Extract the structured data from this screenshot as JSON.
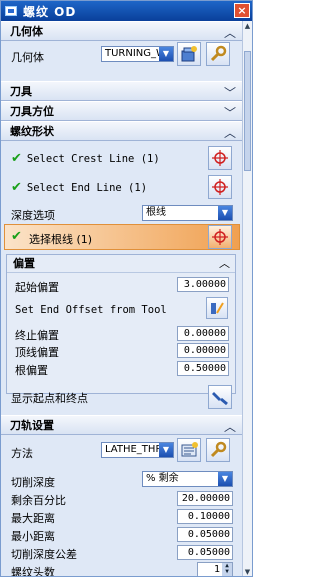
{
  "window": {
    "title": "螺纹 OD",
    "close_label": "×"
  },
  "geometry_section": {
    "header": "几何体",
    "label": "几何体",
    "value": "TURNING_WO"
  },
  "tool_section": {
    "header": "刀具"
  },
  "tool_orientation_section": {
    "header": "刀具方位"
  },
  "thread_section": {
    "header": "螺纹形状",
    "crest_line": "Select Crest Line (1)",
    "end_line": "Select End Line (1)",
    "depth_option_label": "深度选项",
    "depth_option_value": "根线",
    "root_line": "选择根线 (1)",
    "offset_panel": {
      "header": "偏置",
      "start_offset_label": "起始偏置",
      "start_offset_value": "3.00000",
      "end_offset_from_tool": "Set End Offset from Tool",
      "end_offset_label": "终止偏置",
      "end_offset_value": "0.00000",
      "crest_offset_label": "顶线偏置",
      "crest_offset_value": "0.00000",
      "root_offset_label": "根偏置",
      "root_offset_value": "0.50000"
    },
    "show_start_end_label": "显示起点和终点"
  },
  "path_settings_section": {
    "header": "刀轨设置",
    "method_label": "方法",
    "method_value": "LATHE_THREA",
    "cut_depth_label": "切削深度",
    "cut_depth_value": "% 剩余",
    "remaining_pct_label": "剩余百分比",
    "remaining_pct_value": "20.00000",
    "max_distance_label": "最大距离",
    "max_distance_value": "0.10000",
    "min_distance_label": "最小距离",
    "min_distance_value": "0.05000",
    "cut_depth_tol_label": "切削深度公差",
    "cut_depth_tol_value": "0.05000",
    "thread_count_label": "螺纹头数",
    "thread_count_value": "1"
  },
  "colors": {
    "accent": "#f0a050",
    "title_bar": "#0a3f9a",
    "panel": "#dfe8f6"
  }
}
